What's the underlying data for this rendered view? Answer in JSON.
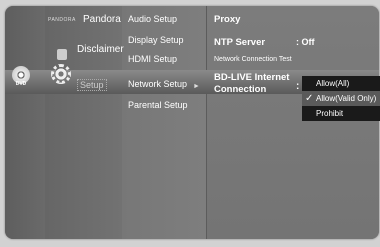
{
  "left_panel": {
    "disc_label": "DVD",
    "pandora_brand": "PANDORA",
    "pandora_label": "Pandora",
    "disclaimer_label": "Disclaimer",
    "setup_label": "Setup"
  },
  "submenu": {
    "items": [
      {
        "label": "Audio Setup"
      },
      {
        "label": "Display Setup"
      },
      {
        "label": "HDMI Setup"
      },
      {
        "label": "Network Setup"
      },
      {
        "label": "Parental Setup"
      }
    ],
    "selected_index": 3,
    "arrow": "►"
  },
  "detail": {
    "proxy_label": "Proxy",
    "ntp_label": "NTP Server",
    "ntp_value": ": Off",
    "connection_test_label": "Network Connection Test",
    "bdlive_line1": "BD-LIVE Internet",
    "bdlive_line2": "Connection",
    "colon": ":"
  },
  "popup": {
    "options": [
      {
        "label": "Allow(All)"
      },
      {
        "label": "Allow(Valid Only)"
      },
      {
        "label": "Prohibit"
      }
    ],
    "checked_index": 1,
    "check_symbol": "✓"
  }
}
